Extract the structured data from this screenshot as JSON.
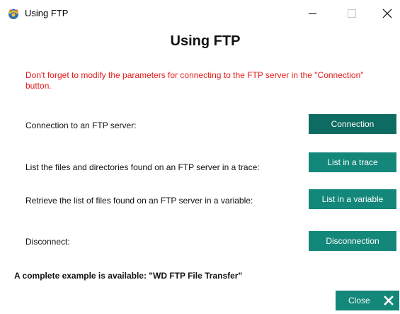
{
  "window": {
    "title": "Using FTP",
    "controls": [
      "minimize",
      "maximize",
      "close"
    ]
  },
  "heading": "Using FTP",
  "warning": "Don't forget to modify the parameters for connecting to the FTP server in the \"Connection\" button.",
  "rows": [
    {
      "label": "Connection to an FTP server:",
      "button": "Connection"
    },
    {
      "label": "List the files and directories found on an FTP server in  a trace:",
      "button": "List in a trace"
    },
    {
      "label": "Retrieve the list of files found on an FTP server in a variable:",
      "button": "List in a variable"
    },
    {
      "label": "Disconnect:",
      "button": "Disconnection"
    }
  ],
  "example_note": "A complete example is available: \"WD FTP File Transfer\"",
  "close_button": {
    "label": "Close",
    "icon": "close-x-icon"
  },
  "colors": {
    "accent": "#13877a",
    "accent_dark": "#0e6b61",
    "warning": "#e51b1b"
  }
}
